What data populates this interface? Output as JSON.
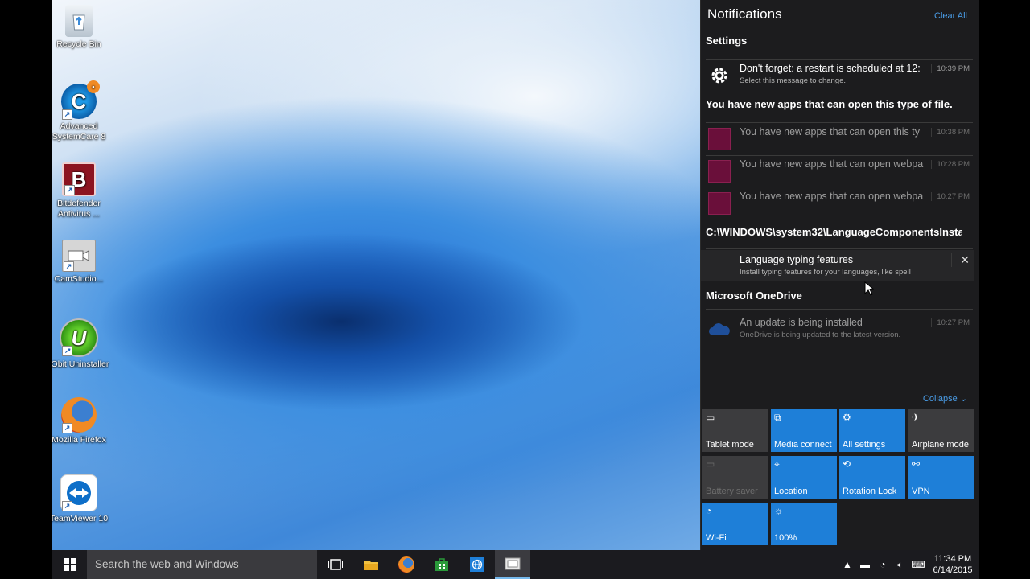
{
  "desktop": {
    "icons": [
      {
        "label": "Recycle Bin"
      },
      {
        "label": "Advanced SystemCare 8"
      },
      {
        "label": "Bitdefender Antivirus ..."
      },
      {
        "label": "CamStudio..."
      },
      {
        "label": "IObit Uninstaller"
      },
      {
        "label": "Mozilla Firefox"
      },
      {
        "label": "TeamViewer 10"
      }
    ]
  },
  "action_center": {
    "title": "Notifications",
    "clear_all": "Clear All",
    "groups": {
      "settings": {
        "title": "Settings",
        "items": [
          {
            "title": "Don't forget: a restart is scheduled at 12:",
            "subtitle": "Select this message to change.",
            "time": "10:39 PM",
            "icon": "gear-icon"
          }
        ]
      },
      "new_apps": {
        "title": "You have new apps that can open this type of file.",
        "items": [
          {
            "title": "You have new apps that can open this ty",
            "time": "10:38 PM"
          },
          {
            "title": "You have new apps that can open webpa",
            "time": "10:28 PM"
          },
          {
            "title": "You have new apps that can open webpa",
            "time": "10:27 PM"
          }
        ]
      },
      "language": {
        "title": "C:\\WINDOWS\\system32\\LanguageComponentsInsta",
        "items": [
          {
            "title": "Language typing features",
            "subtitle": "Install typing features for your languages, like spell"
          }
        ]
      },
      "onedrive": {
        "title": "Microsoft OneDrive",
        "items": [
          {
            "title": "An update is being installed",
            "subtitle": "OneDrive is being updated to the latest version.",
            "time": "10:27 PM",
            "icon": "cloud-icon"
          }
        ]
      }
    },
    "collapse": "Collapse",
    "quick_actions": [
      {
        "label": "Tablet mode",
        "state": "off",
        "icon": "tablet-icon"
      },
      {
        "label": "Media connect",
        "state": "on",
        "icon": "media-connect-icon"
      },
      {
        "label": "All settings",
        "state": "on",
        "icon": "gear-icon"
      },
      {
        "label": "Airplane mode",
        "state": "off",
        "icon": "airplane-icon"
      },
      {
        "label": "Battery saver",
        "state": "disabled",
        "icon": "battery-saver-icon"
      },
      {
        "label": "Location",
        "state": "on",
        "icon": "location-icon"
      },
      {
        "label": "Rotation Lock",
        "state": "on",
        "icon": "rotation-lock-icon"
      },
      {
        "label": "VPN",
        "state": "on",
        "icon": "vpn-icon"
      },
      {
        "label": "Wi-Fi",
        "state": "on",
        "icon": "wifi-icon"
      },
      {
        "label": "100%",
        "state": "on",
        "icon": "brightness-icon"
      }
    ]
  },
  "taskbar": {
    "search_placeholder": "Search the web and Windows",
    "time": "11:34 PM",
    "date": "6/14/2015"
  },
  "colors": {
    "accent": "#1e7fd8",
    "link": "#4a9de8",
    "panel_bg": "#1c1c1e",
    "taskbar_bg": "#1b1b1f"
  }
}
